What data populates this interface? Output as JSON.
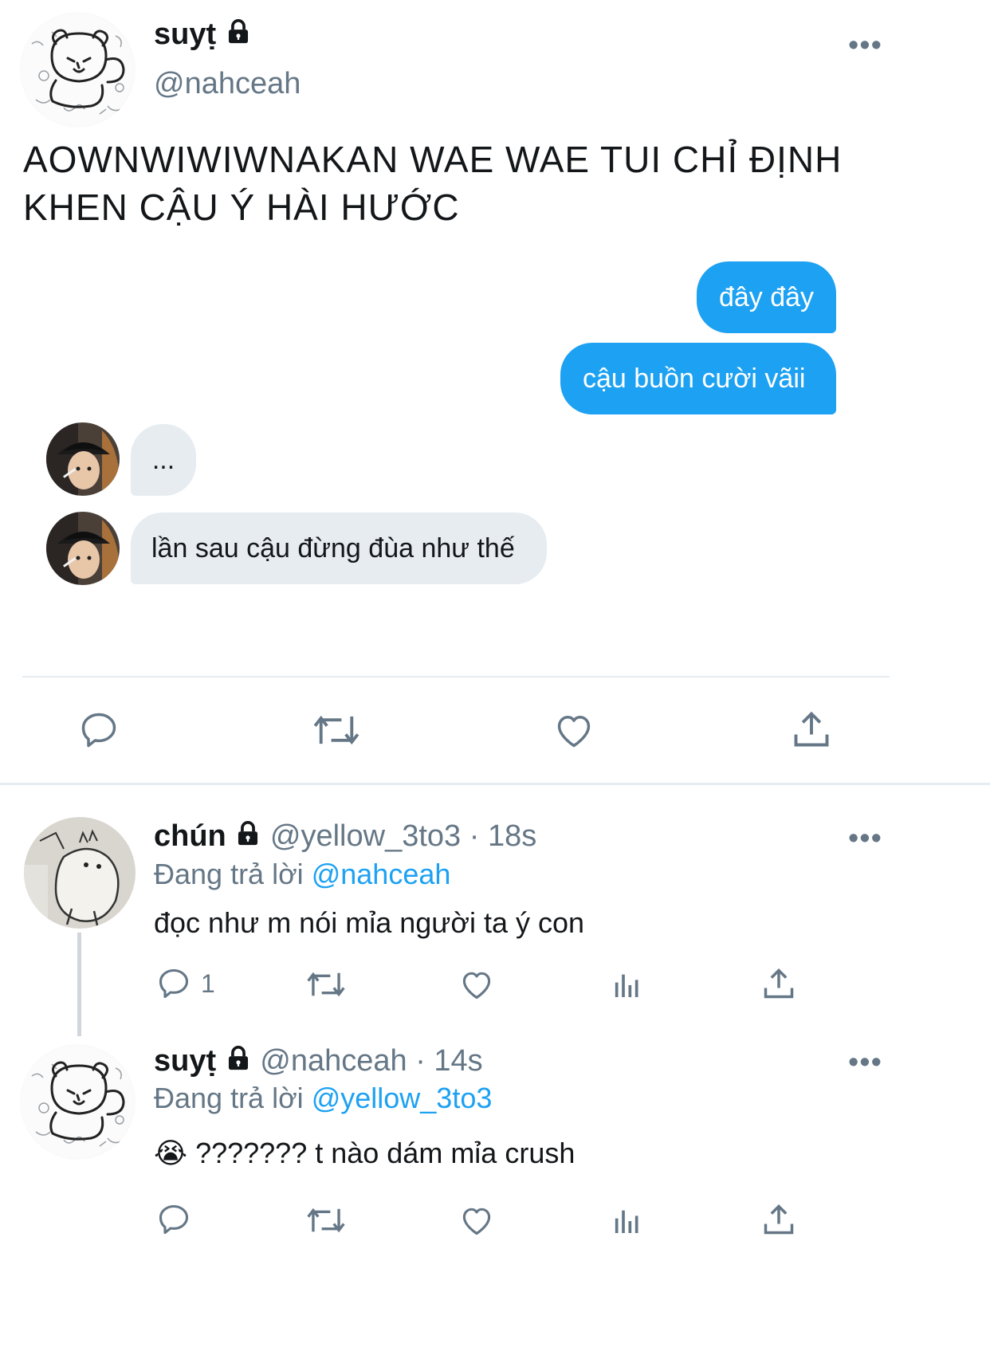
{
  "main_tweet": {
    "display_name": "suyṭ",
    "handle": "@nahceah",
    "text_line1": "AOWNWIWIWNAKAN WAE WAE TUI CHỈ ĐỊNH",
    "text_line2": "KHEN CẬU Ý HÀI HƯỚC",
    "more": "•••",
    "chat": {
      "sent": [
        "đây đây",
        "cậu buồn cười vãii"
      ],
      "received": [
        "...",
        "lần sau cậu đừng đùa như thế"
      ]
    },
    "actions": [
      "reply-icon",
      "retweet-icon",
      "like-icon",
      "share-icon"
    ]
  },
  "replies": [
    {
      "display_name": "chún",
      "handle_time": "@yellow_3to3 · 18s",
      "replying_prefix": "Đang trả lời",
      "replying_to": "@nahceah",
      "text": "đọc như m nói mỉa người ta ý con",
      "reply_count": "1",
      "more": "•••"
    },
    {
      "display_name": "suyṭ",
      "handle_time": "@nahceah · 14s",
      "replying_prefix": "Đang trả lời",
      "replying_to": "@yellow_3to3",
      "text": "😭 ??????? t nào dám mỉa crush",
      "more": "•••"
    }
  ],
  "colors": {
    "accent": "#1da1f2",
    "muted": "#657786",
    "bubble_gray": "#e6ecf0",
    "text": "#14171a"
  }
}
